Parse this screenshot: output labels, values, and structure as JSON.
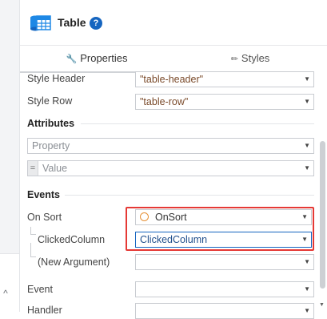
{
  "header": {
    "title": "Table",
    "title_icon": "table-icon",
    "help_icon": "?"
  },
  "tabs": [
    {
      "label": "Properties",
      "icon": "wrench-icon",
      "active": true
    },
    {
      "label": "Styles",
      "icon": "brush-icon",
      "active": false
    }
  ],
  "style_rows": [
    {
      "label": "Style Header",
      "value": "\"table-header\""
    },
    {
      "label": "Style Row",
      "value": "\"table-row\""
    }
  ],
  "attributes": {
    "title": "Attributes",
    "property_placeholder": "Property",
    "value_placeholder": "Value",
    "value_prefix": "="
  },
  "events": {
    "title": "Events",
    "on_sort_label": "On Sort",
    "on_sort_value": "OnSort",
    "clicked_column_label": "ClickedColumn",
    "clicked_column_value": "ClickedColumn",
    "new_argument_label": "(New Argument)",
    "event_label": "Event",
    "handler_label": "Handler"
  },
  "colors": {
    "highlight": "#e53935",
    "accent": "#1565c0",
    "value_text": "#7a4a2a",
    "param_text": "#1f4e8c"
  }
}
